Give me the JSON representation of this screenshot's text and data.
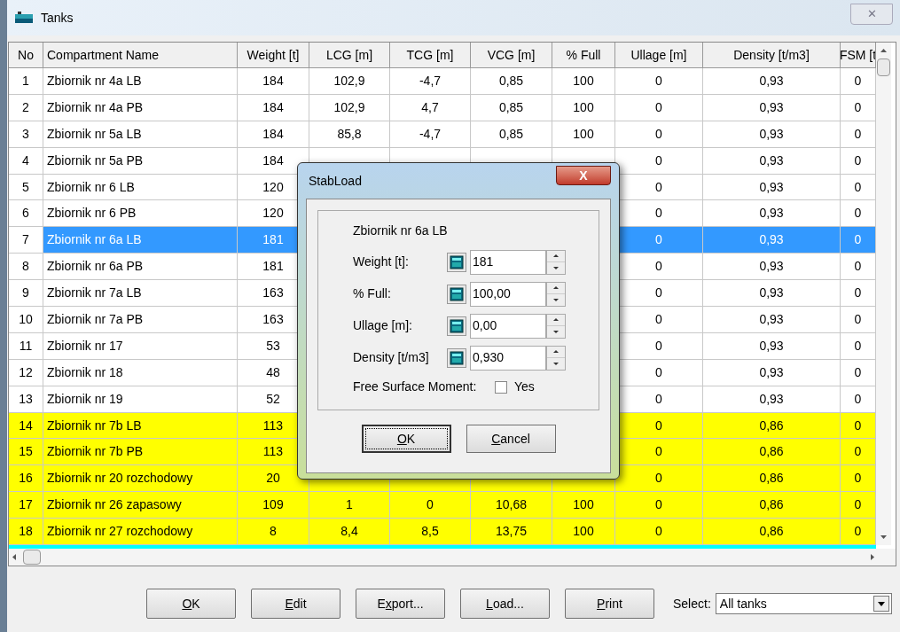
{
  "window": {
    "title": "Tanks",
    "close": "✕"
  },
  "table": {
    "columns": [
      "No",
      "Compartment Name",
      "Weight [t]",
      "LCG [m]",
      "TCG [m]",
      "VCG [m]",
      "% Full",
      "Ullage [m]",
      "Density [t/m3]",
      "FSM [t"
    ],
    "rows": [
      {
        "color": "#ffffff",
        "selected": false,
        "cells": [
          "1",
          "Zbiornik nr 4a LB",
          "184",
          "102,9",
          "-4,7",
          "0,85",
          "100",
          "0",
          "0,93",
          "0"
        ]
      },
      {
        "color": "#ffffff",
        "selected": false,
        "cells": [
          "2",
          "Zbiornik nr 4a PB",
          "184",
          "102,9",
          "4,7",
          "0,85",
          "100",
          "0",
          "0,93",
          "0"
        ]
      },
      {
        "color": "#ffffff",
        "selected": false,
        "cells": [
          "3",
          "Zbiornik nr 5a LB",
          "184",
          "85,8",
          "-4,7",
          "0,85",
          "100",
          "0",
          "0,93",
          "0"
        ]
      },
      {
        "color": "#ffffff",
        "selected": false,
        "cells": [
          "4",
          "Zbiornik nr 5a PB",
          "184",
          null,
          null,
          null,
          null,
          "0",
          "0,93",
          "0"
        ]
      },
      {
        "color": "#ffffff",
        "selected": false,
        "cells": [
          "5",
          "Zbiornik nr 6 LB",
          "120",
          null,
          null,
          null,
          null,
          "0",
          "0,93",
          "0"
        ]
      },
      {
        "color": "#ffffff",
        "selected": false,
        "cells": [
          "6",
          "Zbiornik nr 6 PB",
          "120",
          null,
          null,
          null,
          null,
          "0",
          "0,93",
          "0"
        ]
      },
      {
        "color": "#ffffff",
        "selected": true,
        "cells": [
          "7",
          "Zbiornik nr 6a LB",
          "181",
          null,
          null,
          null,
          null,
          "0",
          "0,93",
          "0"
        ]
      },
      {
        "color": "#ffffff",
        "selected": false,
        "cells": [
          "8",
          "Zbiornik nr 6a PB",
          "181",
          null,
          null,
          null,
          null,
          "0",
          "0,93",
          "0"
        ]
      },
      {
        "color": "#ffffff",
        "selected": false,
        "cells": [
          "9",
          "Zbiornik nr 7a LB",
          "163",
          null,
          null,
          null,
          null,
          "0",
          "0,93",
          "0"
        ]
      },
      {
        "color": "#ffffff",
        "selected": false,
        "cells": [
          "10",
          "Zbiornik nr 7a PB",
          "163",
          null,
          null,
          null,
          null,
          "0",
          "0,93",
          "0"
        ]
      },
      {
        "color": "#ffffff",
        "selected": false,
        "cells": [
          "11",
          "Zbiornik nr 17",
          "53",
          null,
          null,
          null,
          null,
          "0",
          "0,93",
          "0"
        ]
      },
      {
        "color": "#ffffff",
        "selected": false,
        "cells": [
          "12",
          "Zbiornik nr 18",
          "48",
          null,
          null,
          null,
          null,
          "0",
          "0,93",
          "0"
        ]
      },
      {
        "color": "#ffffff",
        "selected": false,
        "cells": [
          "13",
          "Zbiornik nr 19",
          "52",
          null,
          null,
          null,
          null,
          "0",
          "0,93",
          "0"
        ]
      },
      {
        "color": "#ffff00",
        "selected": false,
        "cells": [
          "14",
          "Zbiornik nr 7b LB",
          "113",
          null,
          null,
          null,
          null,
          "0",
          "0,86",
          "0"
        ]
      },
      {
        "color": "#ffff00",
        "selected": false,
        "cells": [
          "15",
          "Zbiornik nr 7b PB",
          "113",
          null,
          null,
          null,
          null,
          "0",
          "0,86",
          "0"
        ]
      },
      {
        "color": "#ffff00",
        "selected": false,
        "cells": [
          "16",
          "Zbiornik nr 20 rozchodowy",
          "20",
          null,
          null,
          null,
          null,
          "0",
          "0,86",
          "0"
        ]
      },
      {
        "color": "#ffff00",
        "selected": false,
        "cells": [
          "17",
          "Zbiornik nr 26 zapasowy",
          "109",
          "1",
          "0",
          "10,68",
          "100",
          "0",
          "0,86",
          "0"
        ]
      },
      {
        "color": "#ffff00",
        "selected": false,
        "cells": [
          "18",
          "Zbiornik nr 27 rozchodowy",
          "8",
          "8,4",
          "8,5",
          "13,75",
          "100",
          "0",
          "0,86",
          "0"
        ]
      },
      {
        "color": "#00ffff"
      }
    ]
  },
  "buttons": [
    {
      "label": "OK"
    },
    {
      "label": "Edit"
    },
    {
      "label": "Export..."
    },
    {
      "label": "Load..."
    },
    {
      "label": "Print"
    }
  ],
  "select": {
    "label": "Select:",
    "value": "All tanks"
  },
  "dialog": {
    "title": "StabLoad",
    "close": "X",
    "tank": "Zbiornik nr 6a LB",
    "fields": [
      {
        "label": "Weight [t]:",
        "value": "181"
      },
      {
        "label": "% Full:",
        "value": "100,00"
      },
      {
        "label": "Ullage [m]:",
        "value": "0,00"
      },
      {
        "label": "Density [t/m3]",
        "value": "0,930"
      }
    ],
    "fsm": {
      "label": "Free Surface Moment:",
      "option": "Yes",
      "checked": false
    },
    "buttons": [
      {
        "label": "OK",
        "default": true
      },
      {
        "label": "Cancel",
        "default": false
      }
    ]
  }
}
